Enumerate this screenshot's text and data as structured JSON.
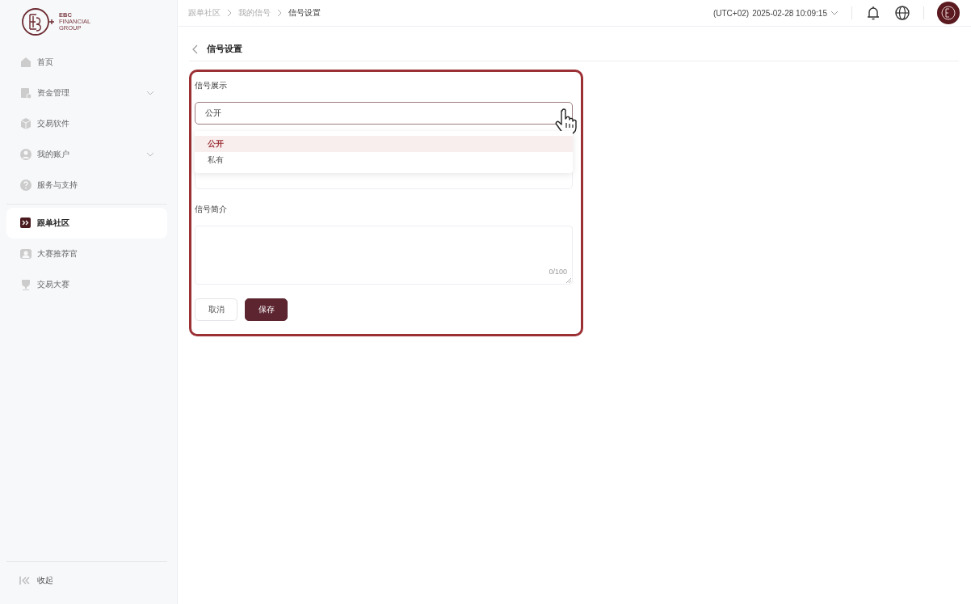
{
  "logo": {
    "lines": [
      "EBC",
      "FINANCIAL",
      "GROUP"
    ]
  },
  "sidebar": {
    "items": [
      {
        "label": "首页",
        "expandable": false,
        "selected": false
      },
      {
        "label": "资金管理",
        "expandable": true,
        "selected": false
      },
      {
        "label": "交易软件",
        "expandable": false,
        "selected": false
      },
      {
        "label": "我的账户",
        "expandable": true,
        "selected": false
      },
      {
        "label": "服务与支持",
        "expandable": false,
        "selected": false
      },
      {
        "label": "跟单社区",
        "expandable": false,
        "selected": true
      },
      {
        "label": "大赛推荐官",
        "expandable": false,
        "selected": false
      },
      {
        "label": "交易大赛",
        "expandable": false,
        "selected": false
      }
    ],
    "collapse_label": "收起"
  },
  "breadcrumb": [
    "跟单社区",
    "我的信号",
    "信号设置"
  ],
  "topbar": {
    "timezone": "(UTC+02)",
    "datetime": "2025-02-28 10:09:15"
  },
  "page_title": "信号设置",
  "form": {
    "display_label": "信号展示",
    "display_value": "公开",
    "dropdown_options": [
      {
        "label": "公开",
        "selected": true
      },
      {
        "label": "私有",
        "selected": false
      }
    ],
    "intro_label": "信号简介",
    "intro_counter": "0/100",
    "buttons": [
      {
        "label": "取消",
        "kind": "secondary"
      },
      {
        "label": "保存",
        "kind": "primary"
      }
    ]
  }
}
